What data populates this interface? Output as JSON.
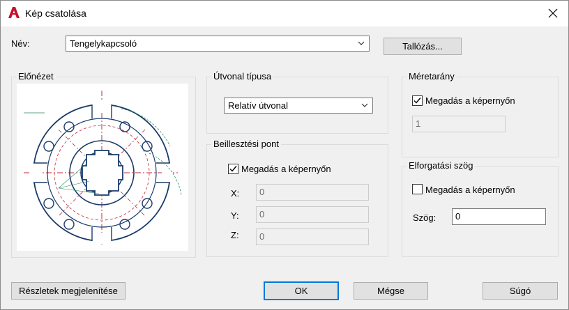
{
  "window": {
    "title": "Kép csatolása",
    "icon": "autocad-a-icon"
  },
  "name_row": {
    "label": "Név:",
    "value": "Tengelykapcsoló",
    "browse_label": "Tallózás..."
  },
  "preview": {
    "title": "Előnézet"
  },
  "path_type": {
    "title": "Útvonal típusa",
    "value": "Relatív útvonal"
  },
  "insertion": {
    "title": "Beillesztési pont",
    "checkbox_label": "Megadás a képernyőn",
    "checked": true,
    "x_label": "X:",
    "x_value": "0",
    "y_label": "Y:",
    "y_value": "0",
    "z_label": "Z:",
    "z_value": "0"
  },
  "scale": {
    "title": "Méretarány",
    "checkbox_label": "Megadás a képernyőn",
    "checked": true,
    "value": "1"
  },
  "rotation": {
    "title": "Elforgatási szög",
    "checkbox_label": "Megadás a képernyőn",
    "checked": false,
    "angle_label": "Szög:",
    "angle_value": "0"
  },
  "buttons": {
    "details": "Részletek megjelenítése",
    "ok": "OK",
    "cancel": "Mégse",
    "help": "Súgó"
  },
  "colors": {
    "accent": "#0078d7",
    "drawing_line": "#1a3a6b",
    "center_line": "#c0283a",
    "dim_line": "#2a8a5a"
  }
}
